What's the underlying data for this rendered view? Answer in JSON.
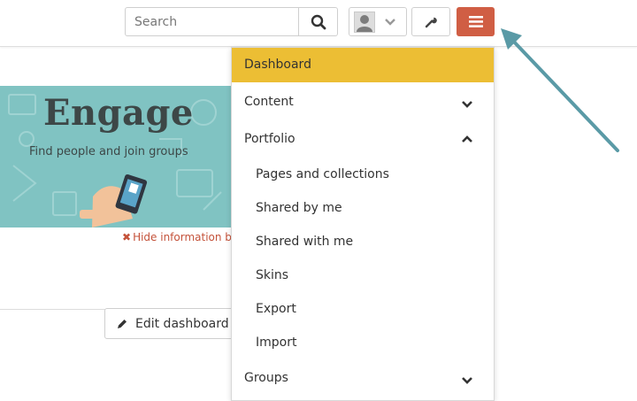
{
  "header": {
    "search_placeholder": "Search",
    "icons": {
      "search": "search-icon",
      "user": "user-avatar-icon",
      "user_menu": "chevron-down-icon",
      "admin": "wrench-icon",
      "main_menu": "hamburger-icon"
    },
    "colors": {
      "menu_button": "#d05e44"
    }
  },
  "banner": {
    "title": "Engage",
    "subtitle": "Find people and join groups",
    "hide_link": "Hide information bo",
    "hide_icon": "close-x-icon",
    "colors": {
      "background": "#80c3c2",
      "hide_link": "#c4523a"
    }
  },
  "dashboard": {
    "edit_label": "Edit dashboard",
    "edit_icon": "pencil-icon"
  },
  "main_menu": {
    "active_color": "#ecbe34",
    "items": {
      "dashboard": "Dashboard",
      "content": "Content",
      "portfolio": "Portfolio",
      "pages_collections": "Pages and collections",
      "shared_by_me": "Shared by me",
      "shared_with_me": "Shared with me",
      "skins": "Skins",
      "export": "Export",
      "import": "Import",
      "groups": "Groups"
    }
  },
  "annotation": {
    "arrow_color": "#5a9aa6"
  }
}
